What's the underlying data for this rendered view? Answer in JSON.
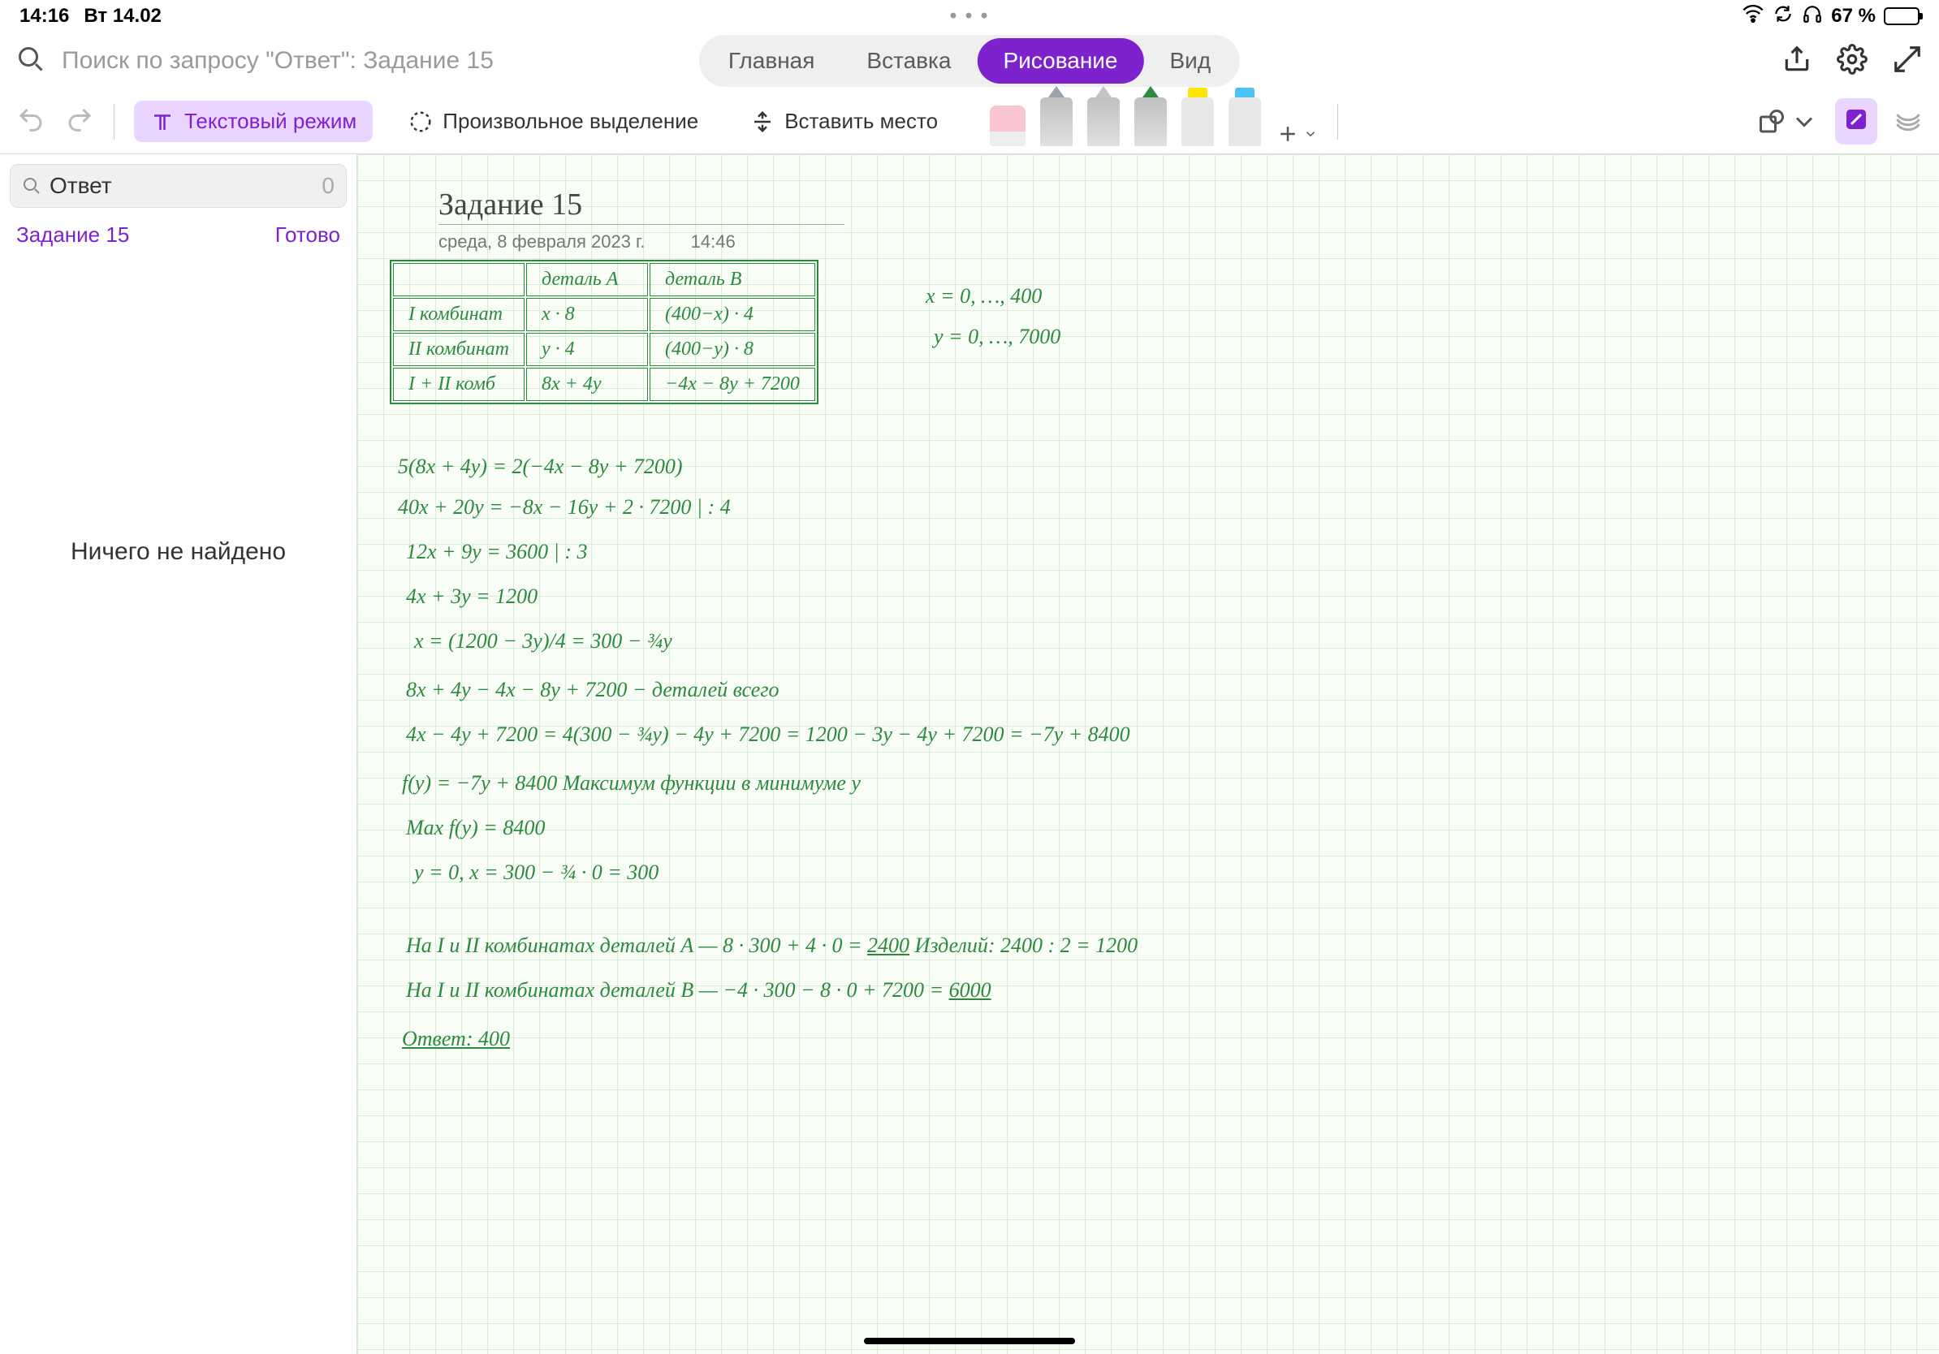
{
  "status": {
    "time": "14:16",
    "date": "Вт 14.02",
    "ellipsis": "• • •",
    "battery": "67 %"
  },
  "header": {
    "search_placeholder": "Поиск по запросу \"Ответ\": Задание 15",
    "tabs": {
      "home": "Главная",
      "insert": "Вставка",
      "draw": "Рисование",
      "view": "Вид"
    }
  },
  "toolbar": {
    "text_mode": "Текстовый режим",
    "lasso": "Произвольное выделение",
    "insert_space": "Вставить место"
  },
  "sidebar": {
    "search_value": "Ответ",
    "count": "0",
    "result_title": "Задание 15",
    "result_action": "Готово",
    "no_results": "Ничего не найдено"
  },
  "note": {
    "title": "Задание 15",
    "date": "среда, 8 февраля 2023 г.",
    "time": "14:46",
    "table": {
      "h1": "",
      "h2": "деталь A",
      "h3": "деталь B",
      "r1c1": "I комбинат",
      "r1c2": "x · 8",
      "r1c3": "(400−x) · 4",
      "r2c1": "II комбинат",
      "r2c2": "y · 4",
      "r2c3": "(400−y) · 8",
      "r3c1": "I + II комб",
      "r3c2": "8x + 4y",
      "r3c3": "−4x − 8y + 7200"
    },
    "side1": "x = 0, …, 400",
    "side2": "y = 0, …, 7000",
    "lines": [
      "5(8x + 4y) = 2(−4x − 8y + 7200)",
      "40x + 20y = −8x − 16y + 2 · 7200   | : 4",
      "12x + 9y = 3600   | : 3",
      "4x + 3y = 1200",
      "x = (1200 − 3y)/4 = 300 − ¾y",
      "8x + 4y − 4x − 8y + 7200 − деталей всего",
      "4x − 4y + 7200 = 4(300 − ¾y) − 4y + 7200 = 1200 − 3y − 4y + 7200 = −7y + 8400",
      "f(y) = −7y + 8400     Максимум функции в минимуме y",
      "Max f(y) = 8400",
      "y = 0,  x = 300 − ¾ · 0 = 300"
    ],
    "res1a": "На I и II комбинатах деталей A —  8 · 300 + 4 · 0 = ",
    "res1b": "2400",
    "res1c": "   Изделий: 2400 : 2 = 1200",
    "res2a": "На I и II комбинатах деталей B —  −4 · 300 − 8 · 0 + 7200 = ",
    "res2b": "6000",
    "answer": "Ответ: 400"
  }
}
